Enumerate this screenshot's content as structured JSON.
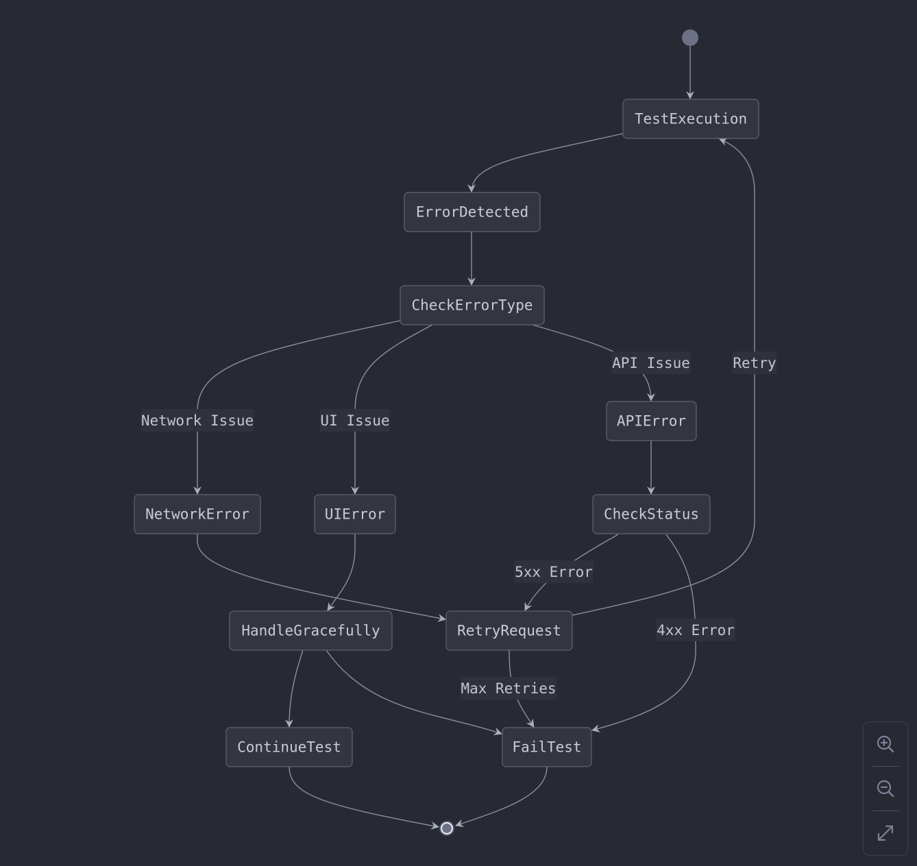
{
  "diagram": {
    "type": "state",
    "start_node": "start",
    "end_node": "end",
    "nodes": [
      {
        "id": "TestExecution",
        "label": "TestExecution"
      },
      {
        "id": "ErrorDetected",
        "label": "ErrorDetected"
      },
      {
        "id": "CheckErrorType",
        "label": "CheckErrorType"
      },
      {
        "id": "APIError",
        "label": "APIError"
      },
      {
        "id": "NetworkError",
        "label": "NetworkError"
      },
      {
        "id": "UIError",
        "label": "UIError"
      },
      {
        "id": "CheckStatus",
        "label": "CheckStatus"
      },
      {
        "id": "HandleGracefully",
        "label": "HandleGracefully"
      },
      {
        "id": "RetryRequest",
        "label": "RetryRequest"
      },
      {
        "id": "ContinueTest",
        "label": "ContinueTest"
      },
      {
        "id": "FailTest",
        "label": "FailTest"
      }
    ],
    "edges": [
      {
        "from": "start",
        "to": "TestExecution",
        "label": ""
      },
      {
        "from": "TestExecution",
        "to": "ErrorDetected",
        "label": ""
      },
      {
        "from": "ErrorDetected",
        "to": "CheckErrorType",
        "label": ""
      },
      {
        "from": "CheckErrorType",
        "to": "NetworkError",
        "label": "Network Issue"
      },
      {
        "from": "CheckErrorType",
        "to": "UIError",
        "label": "UI Issue"
      },
      {
        "from": "CheckErrorType",
        "to": "APIError",
        "label": "API Issue"
      },
      {
        "from": "APIError",
        "to": "CheckStatus",
        "label": ""
      },
      {
        "from": "CheckStatus",
        "to": "RetryRequest",
        "label": "5xx Error"
      },
      {
        "from": "CheckStatus",
        "to": "FailTest",
        "label": "4xx Error"
      },
      {
        "from": "NetworkError",
        "to": "RetryRequest",
        "label": ""
      },
      {
        "from": "UIError",
        "to": "HandleGracefully",
        "label": ""
      },
      {
        "from": "RetryRequest",
        "to": "TestExecution",
        "label": "Retry"
      },
      {
        "from": "RetryRequest",
        "to": "FailTest",
        "label": "Max Retries"
      },
      {
        "from": "HandleGracefully",
        "to": "ContinueTest",
        "label": ""
      },
      {
        "from": "HandleGracefully",
        "to": "FailTest",
        "label": ""
      },
      {
        "from": "ContinueTest",
        "to": "end",
        "label": ""
      },
      {
        "from": "FailTest",
        "to": "end",
        "label": ""
      }
    ]
  },
  "controls": {
    "zoom_in": "zoom-in-icon",
    "zoom_out": "zoom-out-icon",
    "fit": "expand-icon"
  },
  "colors": {
    "background": "#282a33",
    "node_fill": "#33363f",
    "node_stroke": "#5f6476",
    "edge": "#8a8fa3",
    "text": "#c9ccd6",
    "start_dot": "#6c7186"
  }
}
